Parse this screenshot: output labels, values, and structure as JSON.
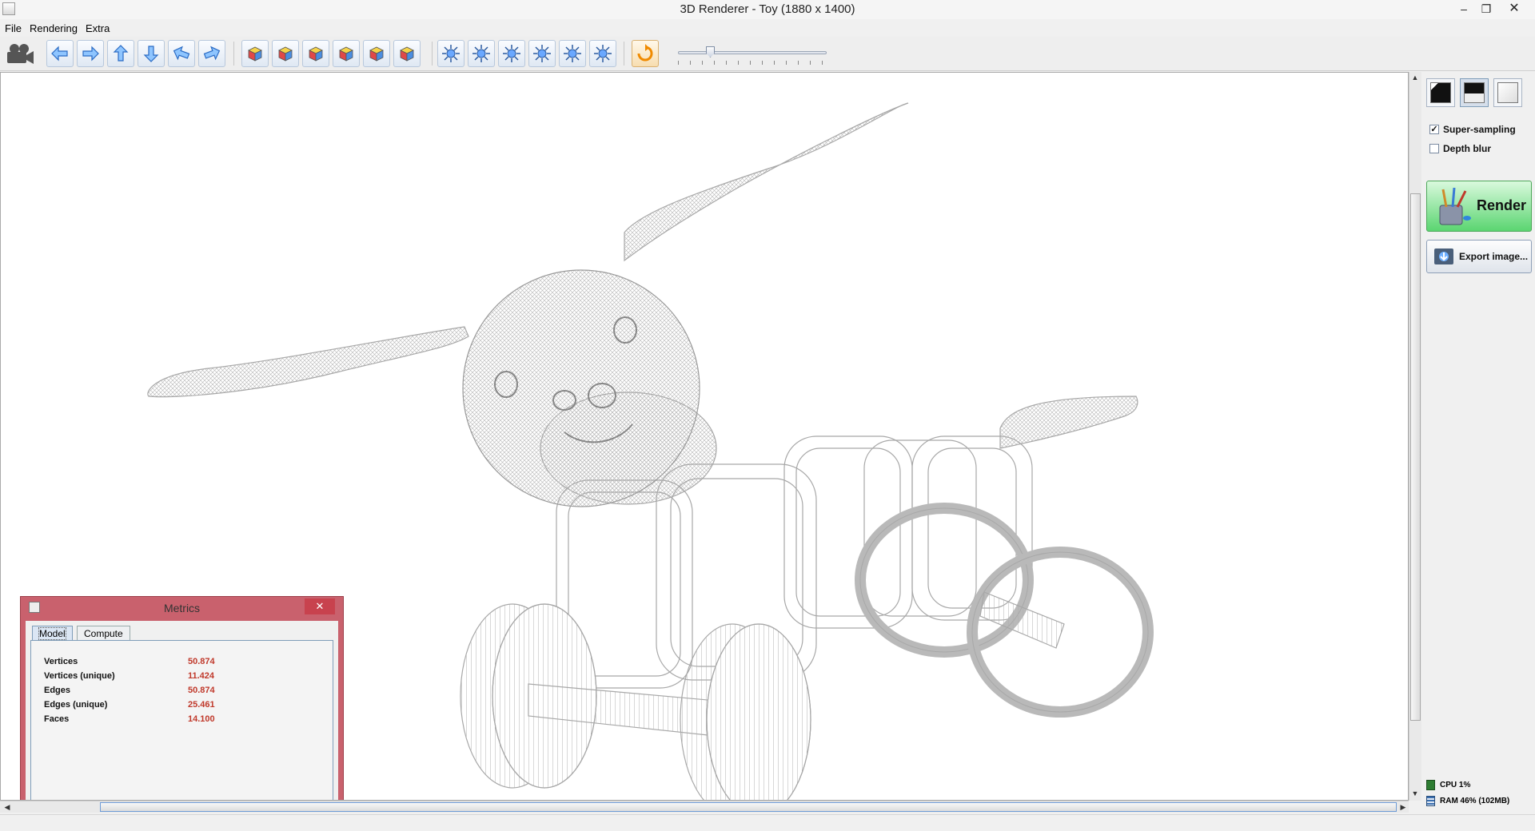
{
  "window": {
    "title": "3D Renderer - Toy (1880 x 1400)",
    "minimize_icon": "minimize-icon",
    "restore_icon": "restore-icon",
    "close_icon": "close-icon"
  },
  "menu": [
    "File",
    "Rendering",
    "Extra"
  ],
  "toolbar": {
    "camera_icon": "camera-icon",
    "move_buttons": [
      "move-left-icon",
      "move-right-icon",
      "move-up-icon",
      "rotate-vertical-icon",
      "tilt-left-icon",
      "tilt-right-icon"
    ],
    "view_buttons": [
      "view-front-icon",
      "view-back-icon",
      "view-top-icon",
      "view-bottom-icon",
      "view-left-icon",
      "view-right-icon"
    ],
    "light_buttons": [
      "light-1-icon",
      "light-2-icon",
      "light-3-icon",
      "light-4-icon",
      "light-5-icon",
      "light-6-icon"
    ],
    "reset_icon": "reset-rotation-icon",
    "zoom_slider_value": 0.2
  },
  "right_panel": {
    "backgrounds": [
      "background-dark-icon",
      "background-gradient-icon",
      "background-white-icon"
    ],
    "super_sampling": {
      "label": "Super-sampling",
      "checked": true
    },
    "depth_blur": {
      "label": "Depth blur",
      "checked": false
    },
    "render_label": "Render",
    "export_label": "Export image...",
    "cpu": "CPU 1%",
    "ram": "RAM 46% (102MB)"
  },
  "metrics": {
    "title": "Metrics",
    "tabs": [
      "Model",
      "Compute"
    ],
    "active_tab": "Model",
    "rows": [
      {
        "label": "Vertices",
        "value": "50.874"
      },
      {
        "label": "Vertices (unique)",
        "value": "11.424"
      },
      {
        "label": "Edges",
        "value": "50.874"
      },
      {
        "label": "Edges (unique)",
        "value": "25.461"
      },
      {
        "label": "Faces",
        "value": "14.100"
      }
    ]
  },
  "colors": {
    "accent": "#5bd571",
    "metrics_frame": "#c9616d",
    "metric_value": "#c0392b",
    "wireframe": "#a8a8a8"
  }
}
